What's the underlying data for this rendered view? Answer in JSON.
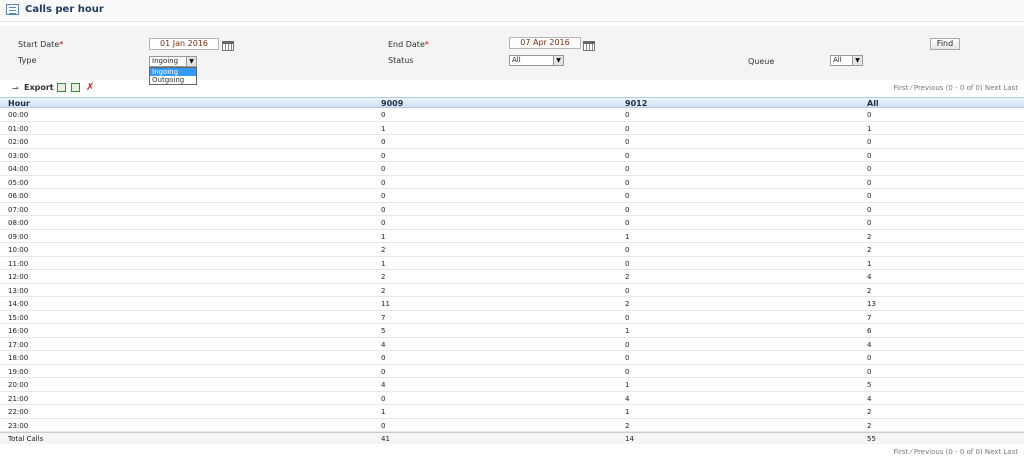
{
  "page": {
    "title": "Calls per hour"
  },
  "filters": {
    "start_date_label": "Start Date",
    "start_date_value": "01 Jan 2016",
    "end_date_label": "End Date",
    "end_date_value": "07 Apr 2016",
    "required_mark": "*",
    "type_label": "Type",
    "type_value": "Ingoing",
    "type_options": [
      "Ingoing",
      "Outgoing"
    ],
    "status_label": "Status",
    "status_value": "All",
    "queue_label": "Queue",
    "queue_value": "All",
    "find_label": "Find"
  },
  "toolbar": {
    "export_label": "Export",
    "pager_text": "First  ⁄  Previous (0 - 0 of 0) Next  Last"
  },
  "table": {
    "headers": [
      "Hour",
      "9009",
      "9012",
      "All"
    ],
    "rows": [
      [
        "00:00",
        "0",
        "0",
        "0"
      ],
      [
        "01:00",
        "1",
        "0",
        "1"
      ],
      [
        "02:00",
        "0",
        "0",
        "0"
      ],
      [
        "03:00",
        "0",
        "0",
        "0"
      ],
      [
        "04:00",
        "0",
        "0",
        "0"
      ],
      [
        "05:00",
        "0",
        "0",
        "0"
      ],
      [
        "06:00",
        "0",
        "0",
        "0"
      ],
      [
        "07:00",
        "0",
        "0",
        "0"
      ],
      [
        "08:00",
        "0",
        "0",
        "0"
      ],
      [
        "09:00",
        "1",
        "1",
        "2"
      ],
      [
        "10:00",
        "2",
        "0",
        "2"
      ],
      [
        "11:00",
        "1",
        "0",
        "1"
      ],
      [
        "12:00",
        "2",
        "2",
        "4"
      ],
      [
        "13:00",
        "2",
        "0",
        "2"
      ],
      [
        "14:00",
        "11",
        "2",
        "13"
      ],
      [
        "15:00",
        "7",
        "0",
        "7"
      ],
      [
        "16:00",
        "5",
        "1",
        "6"
      ],
      [
        "17:00",
        "4",
        "0",
        "4"
      ],
      [
        "18:00",
        "0",
        "0",
        "0"
      ],
      [
        "19:00",
        "0",
        "0",
        "0"
      ],
      [
        "20:00",
        "4",
        "1",
        "5"
      ],
      [
        "21:00",
        "0",
        "4",
        "4"
      ],
      [
        "22:00",
        "1",
        "1",
        "2"
      ],
      [
        "23:00",
        "0",
        "2",
        "2"
      ]
    ],
    "totals": [
      "Total Calls",
      "41",
      "14",
      "55"
    ]
  },
  "colors": {
    "accent": "#1f3c66",
    "header_bg": "#cfe0f2",
    "selected": "#3399ff",
    "required": "#cc0000"
  }
}
